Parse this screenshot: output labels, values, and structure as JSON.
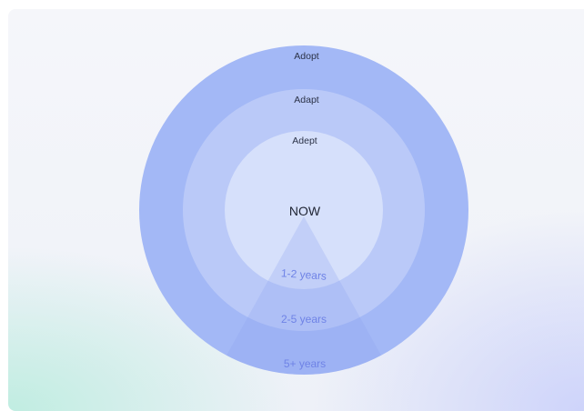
{
  "diagram": {
    "center_label": "NOW",
    "rings": [
      {
        "label": "Adopt"
      },
      {
        "label": "Adapt"
      },
      {
        "label": "Adept"
      }
    ],
    "horizons": [
      {
        "label": "1-2 years"
      },
      {
        "label": "2-5 years"
      },
      {
        "label": "5+ years"
      }
    ],
    "colors": {
      "outer_ring": "#a3b8f6",
      "middle_ring": "#bac9f8",
      "inner_ring": "#d6e0fb",
      "wedge": "#8fa6f1",
      "horizon_text": "#6f83e6"
    }
  }
}
